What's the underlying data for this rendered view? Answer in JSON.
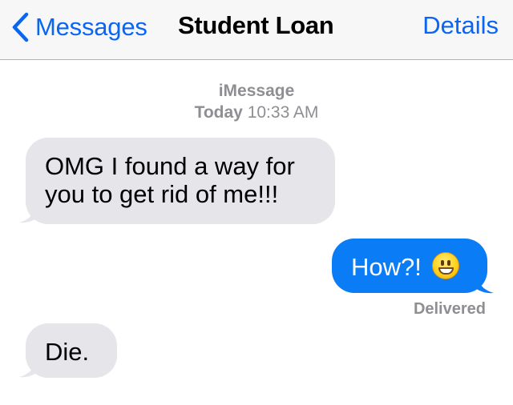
{
  "nav": {
    "back_label": "Messages",
    "title": "Student Loan",
    "details_label": "Details"
  },
  "thread_header": {
    "service": "iMessage",
    "day": "Today",
    "time": "10:33 AM"
  },
  "messages": [
    {
      "direction": "incoming",
      "lines": [
        "OMG I found a way for",
        "you to get rid of me!!!"
      ]
    },
    {
      "direction": "outgoing",
      "text": "How?!",
      "emoji": "grinning-face-emoji"
    },
    {
      "direction": "incoming",
      "text": "Die."
    }
  ],
  "delivery_status": "Delivered",
  "colors": {
    "accent": "#0a66f0",
    "outgoing_bubble": "#0a7cf6",
    "incoming_bubble": "#e5e5ea",
    "meta_text": "#8e8e93"
  }
}
